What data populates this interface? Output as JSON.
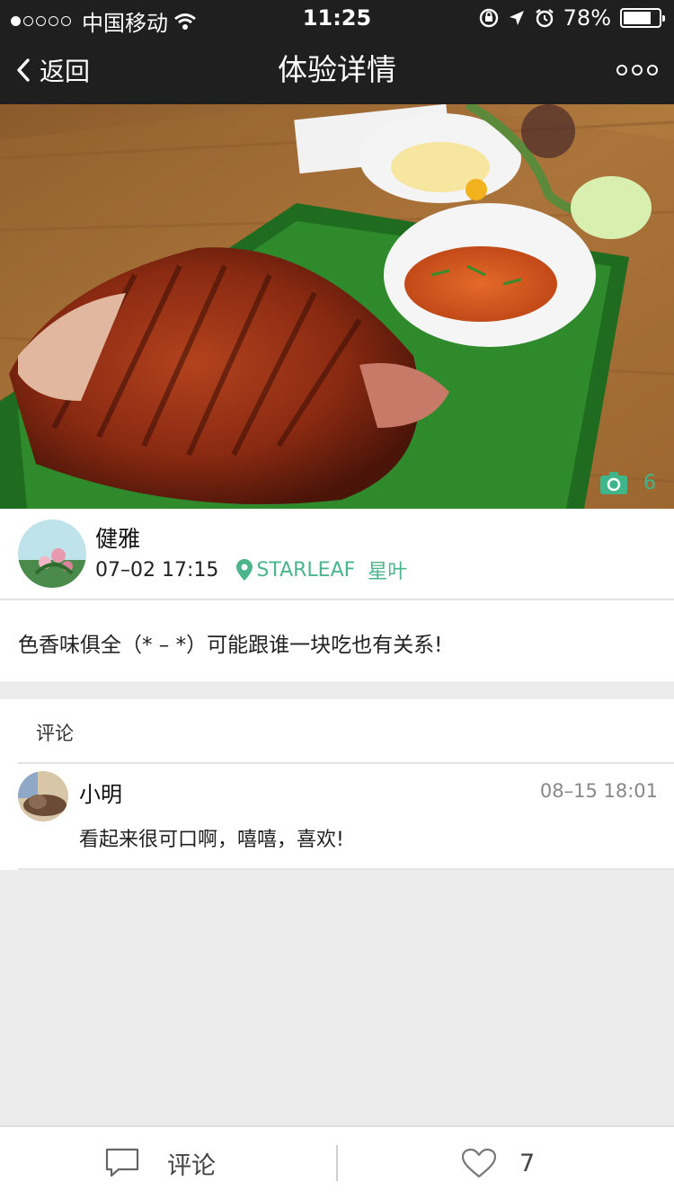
{
  "status_bar": {
    "carrier": "中国移动",
    "time": "11:25",
    "battery_percent": "78%",
    "battery_level": 0.78,
    "signal_bars_filled": 1,
    "signal_bars_total": 5
  },
  "nav": {
    "back_label": "返回",
    "title": "体验详情"
  },
  "photo": {
    "count": "6"
  },
  "author": {
    "name": "健雅",
    "datetime": "07–02 17:15",
    "location_en": "STARLEAF",
    "location_zh": "星叶"
  },
  "post": {
    "text": "色香味俱全（* – *）可能跟谁一块吃也有关系!"
  },
  "comments": {
    "heading": "评论",
    "items": [
      {
        "name": "小明",
        "time": "08–15 18:01",
        "text": "看起来很可口啊，嘻嘻，喜欢!"
      }
    ]
  },
  "bottom_bar": {
    "comment_label": "评论",
    "like_count": "7"
  },
  "colors": {
    "bar_dark": "#1f1f1f",
    "accent_green": "#4bb58b",
    "page_bg": "#ececec"
  }
}
